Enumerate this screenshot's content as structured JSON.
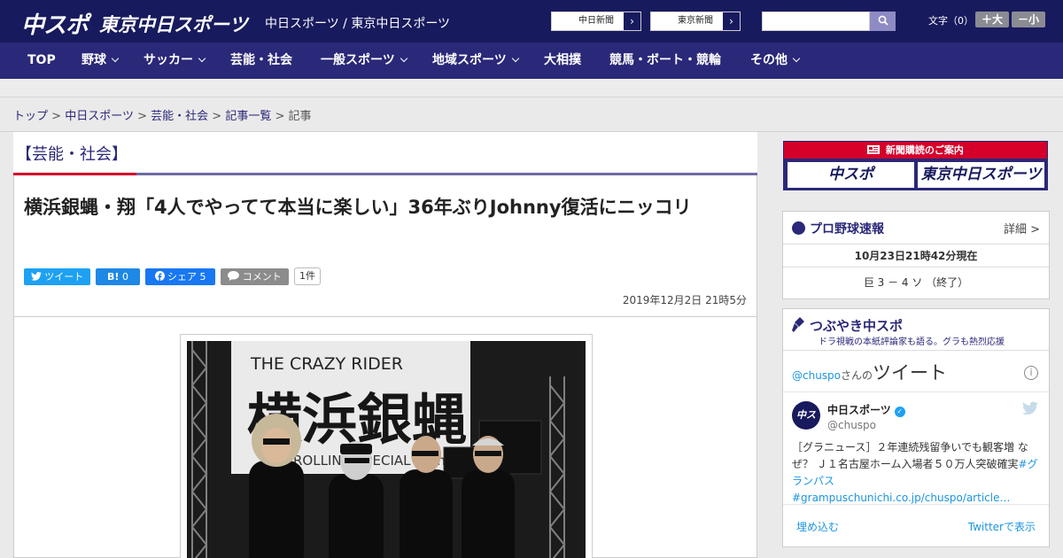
{
  "header": {
    "logo_main": "中スポ",
    "logo_sub": "東京中日スポーツ",
    "site_title": "中日スポーツ / 東京中日スポーツ",
    "paper_links": [
      {
        "label": "中日新聞",
        "chevron": "›"
      },
      {
        "label": "東京新聞",
        "chevron": "›"
      }
    ],
    "search": {
      "placeholder": "",
      "button_icon": "search-icon"
    },
    "fontsize_label": "文字（0）",
    "fontsize_large": "＋大",
    "fontsize_small": "－小"
  },
  "nav": {
    "items": [
      {
        "label": "TOP",
        "dropdown": false
      },
      {
        "label": "野球",
        "dropdown": true
      },
      {
        "label": "サッカー",
        "dropdown": true
      },
      {
        "label": "芸能・社会",
        "dropdown": false
      },
      {
        "label": "一般スポーツ",
        "dropdown": true
      },
      {
        "label": "地域スポーツ",
        "dropdown": true
      },
      {
        "label": "大相撲",
        "dropdown": false
      },
      {
        "label": "競馬・ボート・競輪",
        "dropdown": false
      },
      {
        "label": "その他",
        "dropdown": true
      }
    ]
  },
  "breadcrumb": {
    "items": [
      "トップ",
      "中日スポーツ",
      "芸能・社会",
      "記事一覧"
    ],
    "separator": ">",
    "current": "記事"
  },
  "article": {
    "category": "【芸能・社会】",
    "title": "横浜銀蝿・翔「4人でやってて本当に楽しい」36年ぶりJohnny復活にニッコリ",
    "share": {
      "twitter": "ツイート",
      "hatena_mark": "B!",
      "hatena_count": "0",
      "facebook": "シェア",
      "facebook_count": "5",
      "comment": "コメント",
      "comment_count": "1件"
    },
    "date": "2019年12月2日 21時5分",
    "photo_text_top": "THE CRAZY RIDER",
    "photo_text_main": "横浜銀蝿",
    "photo_text_sub": "ROLLING SPECIAL 40th"
  },
  "sidebar": {
    "subscription_head": "新聞購読のご案内",
    "subscription_logos": [
      "中スポ",
      "東京中日スポーツ"
    ],
    "baseball": {
      "title": "プロ野球速報",
      "detail": "詳細 >",
      "updated": "10月23日21時42分現在",
      "score": "巨 3 － 4 ソ （終了）"
    },
    "tweet_widget": {
      "title": "つぶやき中スポ",
      "subtitle": "ドラ視戦の本紙評論家も語る。グラも熱烈応援",
      "header_handle": "@chuspo",
      "header_suffix": "さんの",
      "header_big": "ツイート",
      "account_name": "中日スポーツ",
      "account_handle": "@chuspo",
      "text_plain": "［グラニュース］２年連続残留争いでも観客増 なぜ？ Ｊ１名古屋ホーム入場者５０万人突破確実",
      "text_hashtag": "#グランパス",
      "text_link": "#grampuschunichi.co.jp/chuspo/article…",
      "embed": "埋め込む",
      "view_on": "Twitterで表示"
    }
  },
  "colors": {
    "header_bg": "#181a5e",
    "nav_bg": "#2a2878",
    "accent_red": "#d4002a",
    "twitter_blue": "#1da1f2",
    "facebook_blue": "#1877f2"
  }
}
